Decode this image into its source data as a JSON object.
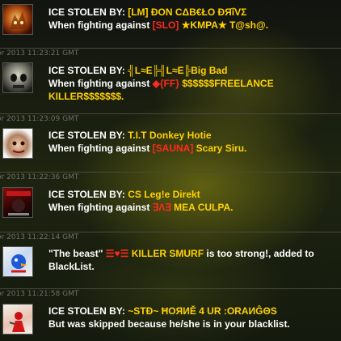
{
  "entries": [
    {
      "prefix": "ICE STOLEN BY: ",
      "stealer": "[LM] ÐΟΝ CΔΒ€ŁΟ ÐЯΐVΣ",
      "line2_text": "When fighting against ",
      "victim_clan": "[SLO]",
      "victim_name": " ★KMPA★ T@sh@.",
      "avatar_icon": "fire-demon-avatar-icon"
    },
    {
      "timestamp": "or 2013 11:23:21 GMT",
      "prefix": "ICE STOLEN BY: ",
      "stealer": "╣L≈E╠╣L≈E╠Big Bad",
      "line2_text": "When fighting against ",
      "victim_clan": "◆{FF}",
      "victim_name": " $$$$$$FREELANCE KILLER$$$$$$$.",
      "avatar_icon": "skull-avatar-icon"
    },
    {
      "timestamp": "or 2013 11:23:09 GMT",
      "prefix": "ICE STOLEN BY: ",
      "stealer": "T.I.T Donkey Hotie",
      "line2_text": "When fighting against ",
      "victim_clan": "[SAUNA]",
      "victim_name": " Scary Siru.",
      "avatar_icon": "face-avatar-icon"
    },
    {
      "timestamp": "or 2013 11:22:36 GMT",
      "prefix": "ICE STOLEN BY: ",
      "stealer": "CS Leg!e Direkt",
      "line2_text": "When fighting against ",
      "victim_clan": "∃Λ∃",
      "victim_name": " MEA CULPA.",
      "avatar_icon": "game-cover-avatar-icon"
    },
    {
      "timestamp": "or 2013 11:22:14 GMT",
      "prefix": "\"The beast\" ",
      "victim_clan": "☰♥☰",
      "victim_name": " KILLER SMURF",
      "suffix": " is too strong!, added to BlackList.",
      "avatar_icon": "blue-bird-avatar-icon"
    },
    {
      "timestamp": "or 2013 11:21:58 GMT",
      "prefix": "ICE STOLEN BY: ",
      "stealer": "~STĐ~ ĦΟЯИĚ 4 UR :ORAИĜΘS",
      "line2_text": "But was skipped because he/she is in your blacklist.",
      "avatar_icon": "red-figure-avatar-icon"
    }
  ]
}
